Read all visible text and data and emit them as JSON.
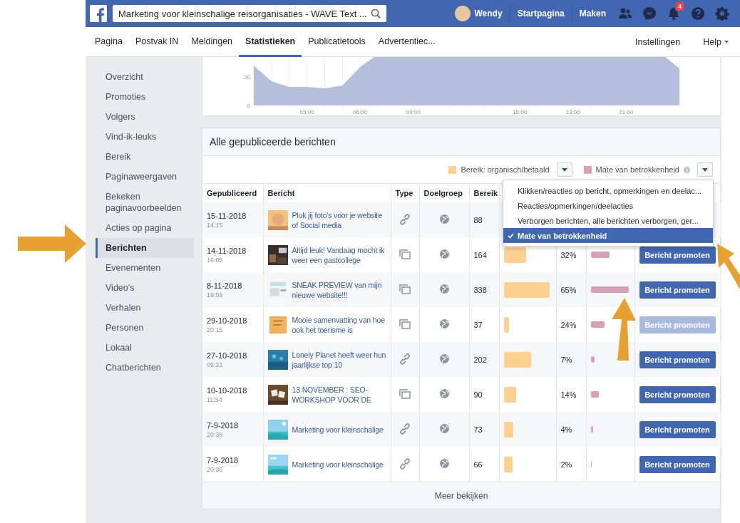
{
  "header": {
    "search": {
      "value": "Marketing voor kleinschalige reisorganisaties - WAVE Text ..."
    },
    "profile": {
      "name": "Wendy"
    },
    "links": [
      "Startpagina",
      "Maken"
    ],
    "notifications": {
      "count": "4"
    }
  },
  "nav": {
    "tabs": [
      {
        "label": "Pagina",
        "selected": false
      },
      {
        "label": "Postvak IN",
        "selected": false
      },
      {
        "label": "Meldingen",
        "selected": false
      },
      {
        "label": "Statistieken",
        "selected": true
      },
      {
        "label": "Publicatietools",
        "selected": false
      },
      {
        "label": "Advertentiec...",
        "selected": false
      }
    ],
    "right": [
      {
        "label": "Instellingen",
        "kind": "link"
      },
      {
        "label": "Help",
        "kind": "menu"
      }
    ]
  },
  "sidebar": {
    "items": [
      {
        "label": "Overzicht",
        "selected": false
      },
      {
        "label": "Promoties",
        "selected": false
      },
      {
        "label": "Volgers",
        "selected": false
      },
      {
        "label": "Vind-ik-leuks",
        "selected": false
      },
      {
        "label": "Bereik",
        "selected": false
      },
      {
        "label": "Paginaweergaven",
        "selected": false
      },
      {
        "label": "Bekeken paginavoorbeelden",
        "selected": false
      },
      {
        "label": "Acties op pagina",
        "selected": false
      },
      {
        "label": "Berichten",
        "selected": true
      },
      {
        "label": "Evenementen",
        "selected": false
      },
      {
        "label": "Video's",
        "selected": false
      },
      {
        "label": "Verhalen",
        "selected": false
      },
      {
        "label": "Personen",
        "selected": false
      },
      {
        "label": "Lokaal",
        "selected": false
      },
      {
        "label": "Chatberichten",
        "selected": false
      }
    ]
  },
  "chart": {
    "y_ticks": [
      "20",
      "0"
    ],
    "x_ticks": [
      "03:00",
      "06:00",
      "09:00",
      "15:00",
      "18:00",
      "21:00"
    ]
  },
  "posts": {
    "title": "Alle gepubliceerde berichten",
    "legend": [
      {
        "label": "Bereik: organisch/betaald",
        "color": "#fcd08e",
        "info": false
      },
      {
        "label": "Mate van betrokkenheid",
        "color": "#d9a0b4",
        "info": true
      }
    ],
    "columns": [
      "Gepubliceerd",
      "Bericht",
      "Type",
      "Doelgroep",
      "Bereik"
    ],
    "dropdown": {
      "items": [
        {
          "label": "Klikken/reacties op bericht, opmerkingen en deelac...",
          "selected": false
        },
        {
          "label": "Reacties/opmerkingen/deelacties",
          "selected": false
        },
        {
          "label": "Verborgen berichten, alle berichten verborgen, ger...",
          "selected": false
        },
        {
          "label": "Mate van betrokkenheid",
          "selected": true
        }
      ]
    },
    "rows": [
      {
        "date": "15-11-2018",
        "time": "14:15",
        "title": "Pluk jij foto's voor je website of Social media",
        "kind": "link",
        "reach": "88"
      },
      {
        "date": "14-11-2018",
        "time": "16:05",
        "title": "Altijd leuk! Vandaag mocht ik weer een gastcollege",
        "kind": "album",
        "reach": "164",
        "engagement": "32%",
        "button": {
          "label": "Bericht promoten",
          "disabled": false
        }
      },
      {
        "date": "8-11-2018",
        "time": "19:59",
        "title": "SNEAK PREVIEW van mijn nieuwe website!!!",
        "kind": "album",
        "reach": "338",
        "engagement": "65%",
        "button": {
          "label": "Bericht promoten",
          "disabled": false
        }
      },
      {
        "date": "29-10-2018",
        "time": "20:15",
        "title": "Mooie samenvatting van hoe ook het toerisme is",
        "kind": "album",
        "reach": "37",
        "engagement": "24%",
        "button": {
          "label": "Bericht promoten",
          "disabled": true
        }
      },
      {
        "date": "27-10-2018",
        "time": "09:21",
        "title": "Lonely Planet heeft weer hun jaarlijkse top 10",
        "kind": "link",
        "reach": "202",
        "engagement": "7%",
        "button": {
          "label": "Bericht promoten",
          "disabled": false
        }
      },
      {
        "date": "10-10-2018",
        "time": "11:54",
        "title": "13 NOVEMBER : SEO-WORKSHOP VOOR DE",
        "kind": "album",
        "reach": "90",
        "engagement": "14%",
        "button": {
          "label": "Bericht promoten",
          "disabled": false
        }
      },
      {
        "date": "7-9-2018",
        "time": "20:38",
        "title": "Marketing voor kleinschalige",
        "kind": "link",
        "reach": "73",
        "engagement": "4%",
        "button": {
          "label": "Bericht promoten",
          "disabled": false
        }
      },
      {
        "date": "7-9-2018",
        "time": "20:36",
        "title": "Marketing voor kleinschalige",
        "kind": "link",
        "reach": "66",
        "engagement": "2%",
        "button": {
          "label": "Bericht promoten",
          "disabled": false
        }
      }
    ],
    "more": "Meer bekijken"
  }
}
